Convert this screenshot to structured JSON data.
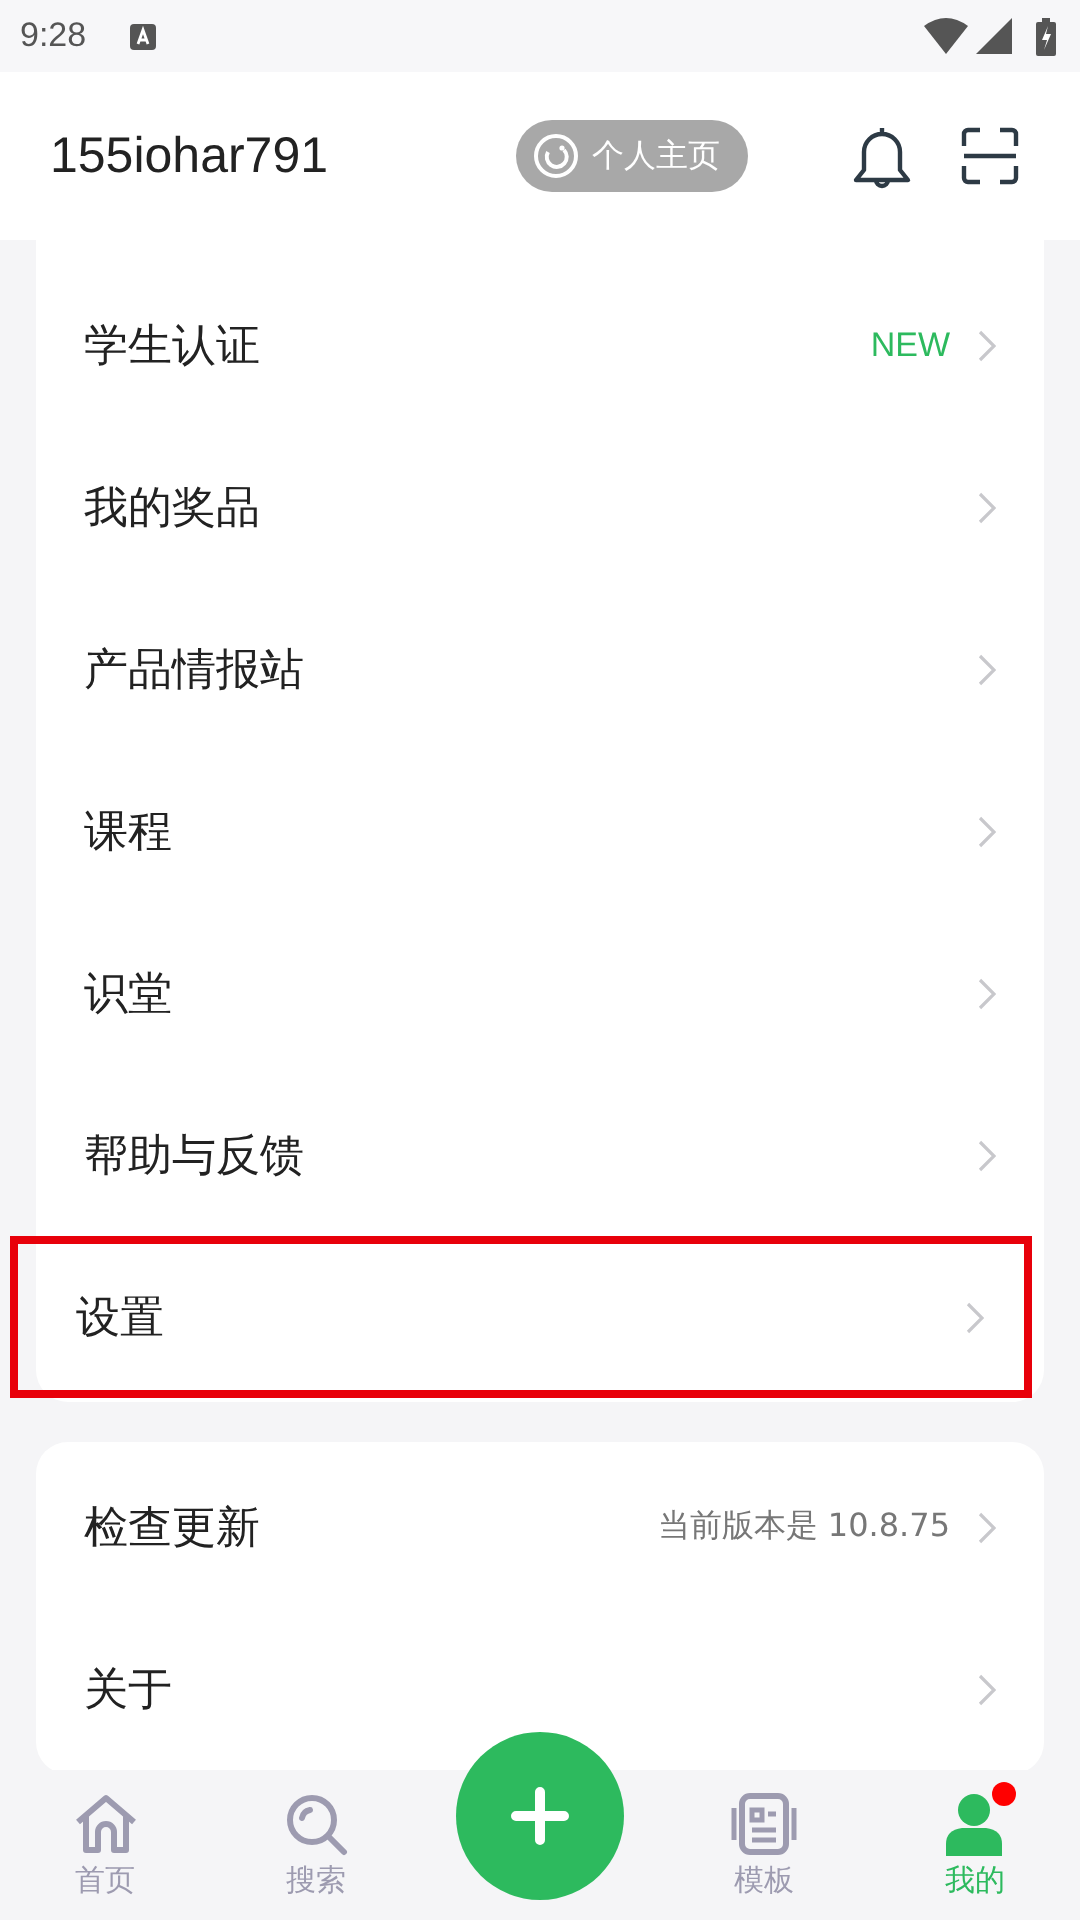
{
  "status_bar": {
    "time": "9:28"
  },
  "header": {
    "username": "155iohar791",
    "profile_button": "个人主页"
  },
  "menu_groups": [
    {
      "items": [
        {
          "label": "学生认证",
          "badge": "NEW",
          "highlighted": false
        },
        {
          "label": "我的奖品",
          "highlighted": false
        },
        {
          "label": "产品情报站",
          "highlighted": false
        },
        {
          "label": "课程",
          "highlighted": false
        },
        {
          "label": "识堂",
          "highlighted": false
        },
        {
          "label": "帮助与反馈",
          "highlighted": false
        },
        {
          "label": "设置",
          "highlighted": true
        }
      ]
    },
    {
      "items": [
        {
          "label": "检查更新",
          "detail": "当前版本是 10.8.75",
          "highlighted": false
        },
        {
          "label": "关于",
          "highlighted": false
        }
      ]
    }
  ],
  "bottom_nav": [
    {
      "kind": "home",
      "label": "首页",
      "selected": false
    },
    {
      "kind": "search",
      "label": "搜索",
      "selected": false
    },
    {
      "kind": "add"
    },
    {
      "kind": "template",
      "label": "模板",
      "selected": false
    },
    {
      "kind": "me",
      "label": "我的",
      "selected": true,
      "notification": true
    }
  ]
}
